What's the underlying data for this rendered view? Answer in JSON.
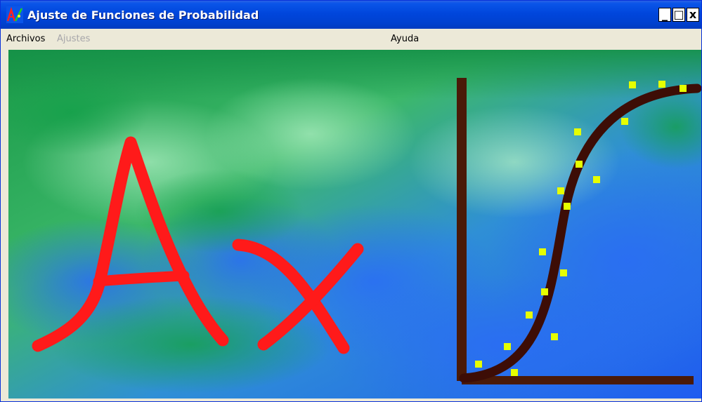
{
  "window": {
    "title": "Ajuste de Funciones de Probabilidad",
    "controls": {
      "minimize": "_",
      "maximize": "□",
      "close": "x"
    }
  },
  "menu": {
    "items": [
      {
        "label": "Archivos",
        "enabled": true
      },
      {
        "label": "Ajustes",
        "enabled": false
      },
      {
        "label": "Ayuda",
        "enabled": true
      }
    ]
  },
  "splash": {
    "logo": "Ax",
    "colors": {
      "letters": "#ff1a1a",
      "axes": "#4a1a08",
      "curve": "#3d0d06",
      "points": "#e6ff00",
      "background_top": "#1a9a48",
      "background_bottom": "#1f5cf0"
    }
  }
}
